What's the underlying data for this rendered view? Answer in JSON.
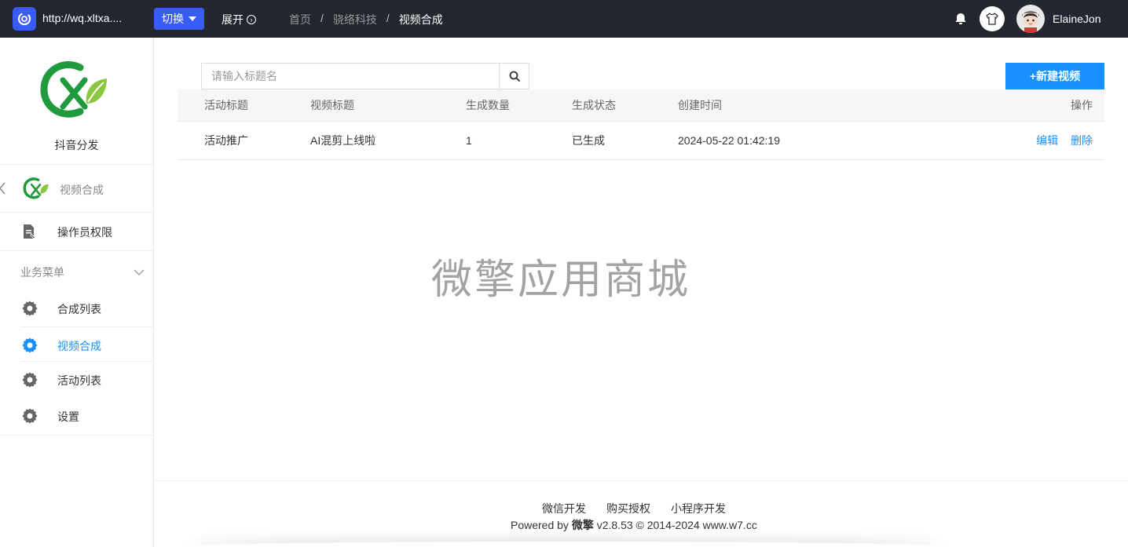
{
  "topbar": {
    "site_url": "http://wq.xltxa....",
    "switch_label": "切换",
    "expand_label": "展开",
    "breadcrumb": [
      "首页",
      "骁络科技",
      "视频合成"
    ],
    "breadcrumb_sep": "/",
    "username": "ElaineJon"
  },
  "sidebar": {
    "brand_name": "抖音分发",
    "app_name": "视频合成",
    "perm_label": "操作员权限",
    "menu_title": "业务菜单",
    "items": [
      {
        "label": "合成列表",
        "active": false
      },
      {
        "label": "视频合成",
        "active": true
      },
      {
        "label": "活动列表",
        "active": false
      },
      {
        "label": "设置",
        "active": false
      }
    ]
  },
  "search": {
    "placeholder": "请输入标题名",
    "value": ""
  },
  "new_button": "+新建视频",
  "table": {
    "headers": [
      "活动标题",
      "视频标题",
      "生成数量",
      "生成状态",
      "创建时间",
      "操作"
    ],
    "rows": [
      {
        "activity": "活动推广",
        "video": "AI混剪上线啦",
        "count": "1",
        "status": "已生成",
        "created": "2024-05-22 01:42:19",
        "edit": "编辑",
        "delete": "删除"
      }
    ]
  },
  "watermark": "微擎应用商城",
  "footer": {
    "links": [
      "微信开发",
      "购买授权",
      "小程序开发"
    ],
    "powered": "Powered by",
    "brand": "微擎",
    "rest": "v2.8.53 © 2014-2024 www.w7.cc"
  },
  "colors": {
    "topbar": "#23262e",
    "accent": "#1890ff",
    "switch": "#3a5cf6"
  }
}
